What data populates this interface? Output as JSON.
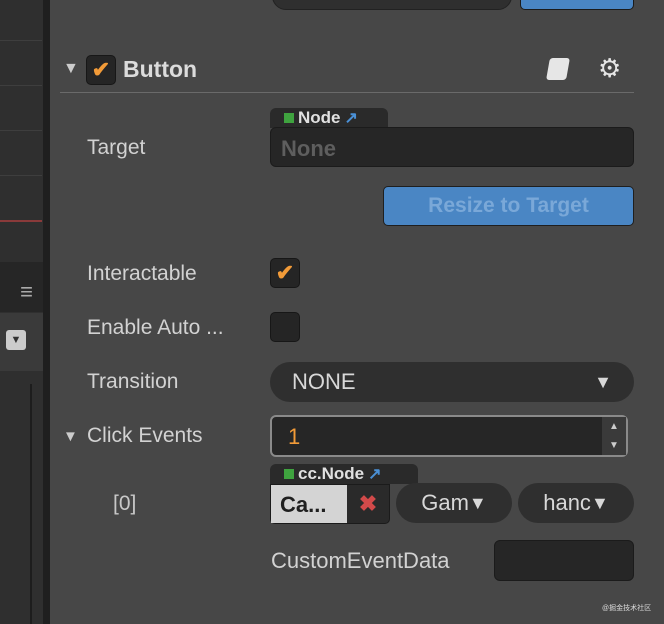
{
  "component": {
    "title": "Button",
    "enabled": true
  },
  "target": {
    "label": "Target",
    "type_tag": "Node",
    "value": "None"
  },
  "resize_button": "Resize to Target",
  "interactable": {
    "label": "Interactable",
    "checked": true
  },
  "enable_auto": {
    "label": "Enable Auto ...",
    "checked": false
  },
  "transition": {
    "label": "Transition",
    "value": "NONE"
  },
  "click_events": {
    "label": "Click Events",
    "count": "1",
    "items": [
      {
        "index": "[0]",
        "type_tag": "cc.Node",
        "node": "Ca...",
        "component": "Gam",
        "handler": "hanc",
        "custom_label": "CustomEventData",
        "custom_value": ""
      }
    ]
  },
  "watermark": "@掘金技术社区",
  "colors": {
    "accent": "#f29b38",
    "button": "#4a86c4",
    "node_tag": "#3fa33f"
  }
}
